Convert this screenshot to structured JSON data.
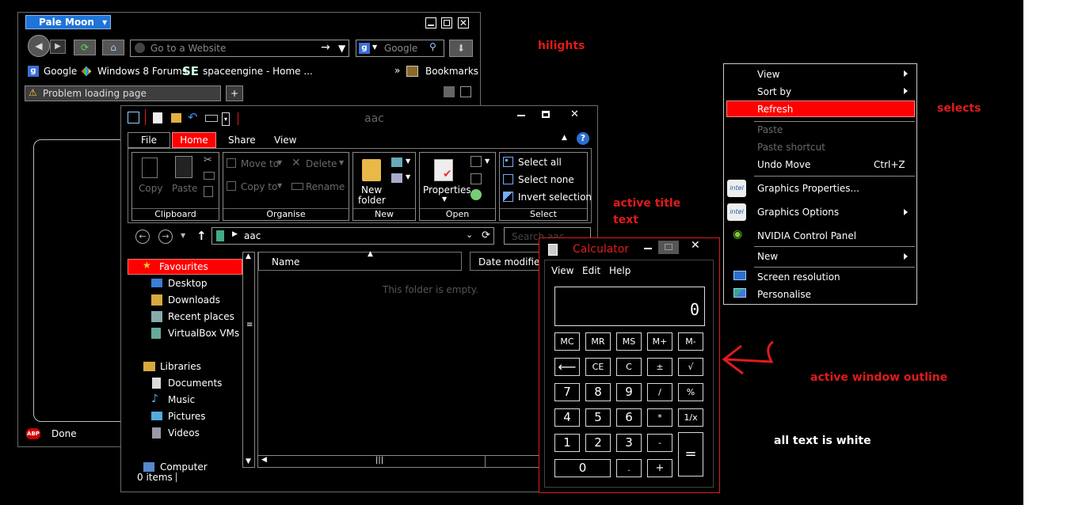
{
  "browser": {
    "app_button": "Pale Moon",
    "url_placeholder": "Go to a Website",
    "search_placeholder": "Google",
    "bookmarks": [
      "Google",
      "Windows 8 Forums",
      "spaceengine - Home ..."
    ],
    "se_badge": "SE",
    "bookmarks_menu": "Bookmarks",
    "tab_title": "Problem loading page",
    "status_text": "Done",
    "abp_badge": "ABP"
  },
  "explorer": {
    "title": "aac",
    "tabs": [
      "File",
      "Home",
      "Share",
      "View"
    ],
    "clipboard": {
      "copy": "Copy",
      "paste": "Paste",
      "label": "Clipboard"
    },
    "organise": {
      "move_to": "Move to",
      "copy_to": "Copy to",
      "delete": "Delete",
      "rename": "Rename",
      "label": "Organise"
    },
    "new": {
      "new_folder_line1": "New",
      "new_folder_line2": "folder",
      "label": "New"
    },
    "open": {
      "properties": "Properties",
      "label": "Open"
    },
    "select": {
      "select_all": "Select all",
      "select_none": "Select none",
      "invert": "Invert selection",
      "label": "Select"
    },
    "path": "aac",
    "search_placeholder": "Search aac",
    "nav": {
      "favourites": "Favourites",
      "fav_items": [
        "Desktop",
        "Downloads",
        "Recent places",
        "VirtualBox VMs"
      ],
      "libraries": "Libraries",
      "lib_items": [
        "Documents",
        "Music",
        "Pictures",
        "Videos"
      ],
      "computer": "Computer"
    },
    "col_name": "Name",
    "col_date": "Date modified",
    "empty_text": "This folder is empty.",
    "status": "0 items"
  },
  "calculator": {
    "title": "Calculator",
    "menu": [
      "View",
      "Edit",
      "Help"
    ],
    "display": "0",
    "mem_buttons": [
      "MC",
      "MR",
      "MS",
      "M+",
      "M-"
    ],
    "row2": [
      "⟵",
      "CE",
      "C",
      "±",
      "√"
    ],
    "row3": [
      "7",
      "8",
      "9",
      "/",
      "%"
    ],
    "row4": [
      "4",
      "5",
      "6",
      "*",
      "1/x"
    ],
    "row5": [
      "1",
      "2",
      "3",
      "-"
    ],
    "row6": [
      "0",
      ".",
      "+"
    ],
    "equals": "="
  },
  "context_menu": {
    "items": {
      "view": "View",
      "sort_by": "Sort by",
      "refresh": "Refresh",
      "paste": "Paste",
      "paste_shortcut": "Paste shortcut",
      "undo_move": "Undo Move",
      "undo_shortcut": "Ctrl+Z",
      "graphics_properties": "Graphics Properties...",
      "graphics_options": "Graphics Options",
      "nvidia": "NVIDIA Control Panel",
      "new": "New",
      "screen_resolution": "Screen resolution",
      "personalise": "Personalise"
    },
    "intel_badge": "intel"
  },
  "annotations": {
    "hilights": "hilights",
    "selects": "selects",
    "active_title_line1": "active title",
    "active_title_line2": "text",
    "active_outline": "active window outline",
    "all_white": "all text is white"
  },
  "colors": {
    "background": "#000000",
    "highlight": "#ff0000",
    "annotation": "#e01b1b",
    "window_border": "#6a6a6a"
  }
}
